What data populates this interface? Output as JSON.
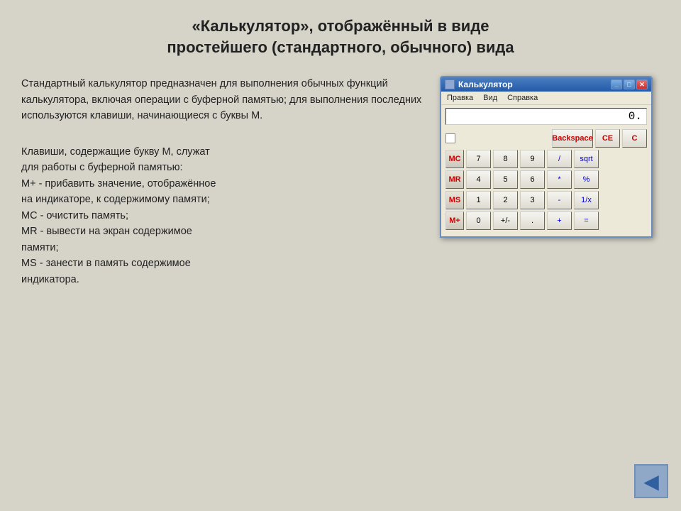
{
  "page": {
    "title_line1": "«Калькулятор», отображённый в виде",
    "title_line2": "простейшего (стандартного, обычного) вида"
  },
  "text": {
    "paragraph1": "Стандартный калькулятор предназначен для выполнения обычных функций калькулятора, включая операции с буферной памятью; для выполнения последних используются клавиши, начинающиеся с буквы М.",
    "paragraph2_line1": "Клавиши, содержащие букву М, служат",
    "paragraph2_line2": "для работы с буферной памятью:",
    "paragraph2_line3": "М+ - прибавить значение, отображённое",
    "paragraph2_line4": "на индикаторе, к содержимому памяти;",
    "paragraph2_line5": "МС - очистить память;",
    "paragraph2_line6": "MR - вывести на экран содержимое",
    "paragraph2_line7": "памяти;",
    "paragraph2_line8": "MS - занести в память содержимое",
    "paragraph2_line9": "индикатора."
  },
  "calculator": {
    "title": "Калькулятор",
    "menu": [
      "Правка",
      "Вид",
      "Справка"
    ],
    "display_value": "0.",
    "title_btn_min": "_",
    "title_btn_max": "□",
    "title_btn_close": "✕",
    "buttons": {
      "row1": [
        "Backspace",
        "CE",
        "C"
      ],
      "row2_mem": "MC",
      "row2_nums": [
        "7",
        "8",
        "9"
      ],
      "row2_ops": [
        "/",
        "sqrt"
      ],
      "row3_mem": "MR",
      "row3_nums": [
        "4",
        "5",
        "6"
      ],
      "row3_ops": [
        "*",
        "%"
      ],
      "row4_mem": "MS",
      "row4_nums": [
        "1",
        "2",
        "3"
      ],
      "row4_ops": [
        "-",
        "1/x"
      ],
      "row5_mem": "M+",
      "row5_nums": [
        "0",
        "+/-",
        "."
      ],
      "row5_ops": [
        "+",
        "="
      ]
    }
  },
  "nav": {
    "back_arrow": "◀"
  }
}
